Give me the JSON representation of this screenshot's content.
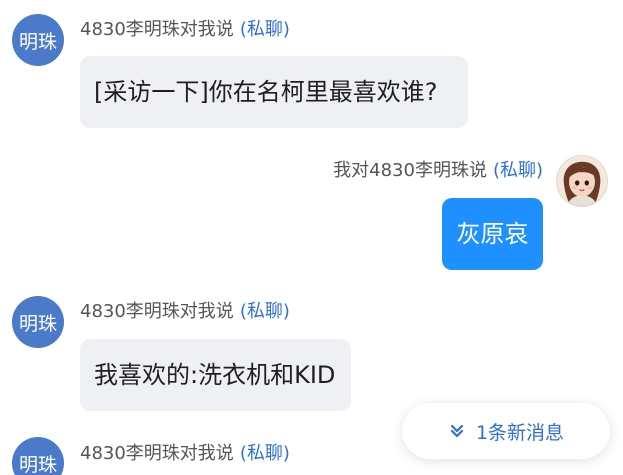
{
  "colors": {
    "avatar_bg": "#4a7ac9",
    "incoming_bubble_bg": "#eef0f4",
    "outgoing_bubble_bg": "#1e90ff",
    "private_tag": "#2f6fd8"
  },
  "messages": [
    {
      "direction": "incoming",
      "avatar_text": "明珠",
      "sender_line": "4830李明珠对我说",
      "tag": "(私聊)",
      "text": "[采访一下]你在名柯里最喜欢谁?"
    },
    {
      "direction": "outgoing",
      "avatar_icon": "user-photo-icon",
      "sender_line": "我对4830李明珠说",
      "tag": "(私聊)",
      "text": "灰原哀"
    },
    {
      "direction": "incoming",
      "avatar_text": "明珠",
      "sender_line": "4830李明珠对我说",
      "tag": "(私聊)",
      "text": "我喜欢的:洗衣机和KID"
    },
    {
      "direction": "incoming",
      "avatar_text": "明珠",
      "sender_line": "4830李明珠对我说",
      "tag": "(私聊)",
      "text": ""
    }
  ],
  "new_message_pill": {
    "icon": "double-chevron-down-icon",
    "label": "1条新消息"
  }
}
